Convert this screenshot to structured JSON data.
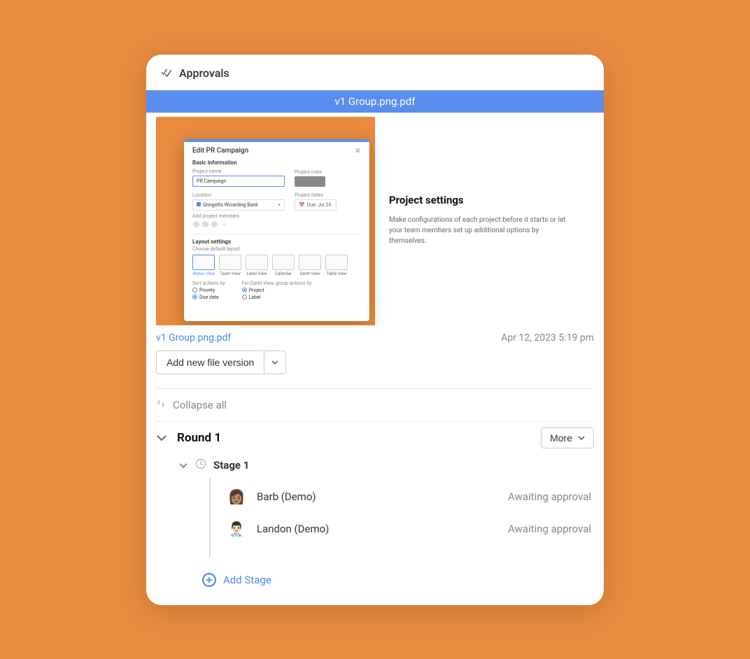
{
  "header": {
    "title": "Approvals"
  },
  "file": {
    "name": "v1 Group.png.pdf",
    "link_label": "v1 Group.png.pdf",
    "timestamp": "Apr 12, 2023 5:19 pm"
  },
  "add_version": {
    "label": "Add new file version"
  },
  "collapse_all": {
    "label": "Collapse all"
  },
  "round": {
    "name": "Round 1",
    "more_label": "More",
    "stage": {
      "name": "Stage 1",
      "approvers": [
        {
          "name": "Barb (Demo)",
          "status": "Awaiting approval",
          "avatar_bg": "#f4c9a3",
          "avatar_emoji": "👩🏽"
        },
        {
          "name": "Landon (Demo)",
          "status": "Awaiting approval",
          "avatar_bg": "#e8e8f5",
          "avatar_emoji": "👨🏻‍⚕️"
        }
      ]
    },
    "add_stage_label": "Add Stage"
  },
  "preview": {
    "right_title": "Project settings",
    "right_body": "Make configurations of each project before it starts or let your team members set up additional options by themselves.",
    "dialog": {
      "title": "Edit PR Campaign",
      "section_basic": "Basic information",
      "project_name_label": "Project name",
      "project_name_value": "PR Campaign",
      "project_color_label": "Project color",
      "location_label": "Location",
      "location_value": "Gringotts Wizarding Bank",
      "project_dates_label": "Project dates",
      "date_value": "Due: Jul 24",
      "members_label": "Add project members",
      "section_layout": "Layout settings",
      "choose_layout_label": "Choose default layout",
      "layouts": [
        "Status View",
        "Team View",
        "Label View",
        "Calendar",
        "Gantt View",
        "Table View"
      ],
      "sort_label": "Sort actions by",
      "sort_options": [
        "Priority",
        "Due date"
      ],
      "gantt_group_label": "For Gantt View, group actions by",
      "gantt_options": [
        "Project",
        "Label"
      ]
    }
  }
}
